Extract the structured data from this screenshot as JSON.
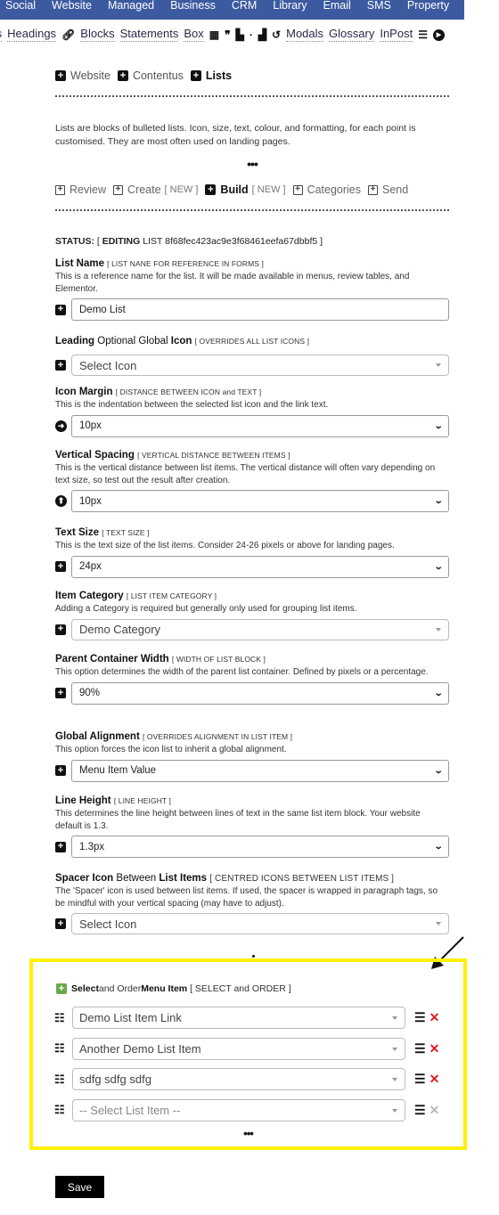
{
  "topnav": {
    "items": [
      "Social",
      "Website",
      "Managed",
      "Business",
      "CRM",
      "Library",
      "Email",
      "SMS",
      "Property"
    ],
    "settings_icon": "gear-icon"
  },
  "toolbar": {
    "items": [
      {
        "type": "link",
        "label": "ts"
      },
      {
        "type": "link",
        "label": "Headings"
      },
      {
        "type": "icon",
        "icon": "link-icon",
        "glyph": "🔗"
      },
      {
        "type": "link",
        "label": "Blocks"
      },
      {
        "type": "link",
        "label": "Statements"
      },
      {
        "type": "link",
        "label": "Box"
      },
      {
        "type": "icon",
        "icon": "calculator-icon",
        "glyph": "▦"
      },
      {
        "type": "icon",
        "icon": "quote-icon",
        "glyph": "❞"
      },
      {
        "type": "icon",
        "icon": "scroll-icon",
        "glyph": "▙"
      },
      {
        "type": "icon",
        "icon": "dot-icon",
        "glyph": "·"
      },
      {
        "type": "icon",
        "icon": "door-icon",
        "glyph": "▟"
      },
      {
        "type": "icon",
        "icon": "undo-icon",
        "glyph": "↺"
      },
      {
        "type": "link",
        "label": "Modals"
      },
      {
        "type": "link",
        "label": "Glossary"
      },
      {
        "type": "link",
        "label": "InPost"
      },
      {
        "type": "icon",
        "icon": "list-icon",
        "glyph": "☰"
      },
      {
        "type": "icon",
        "icon": "play-circle-icon",
        "glyph": "▶"
      }
    ]
  },
  "breadcrumb": [
    {
      "label": "Website",
      "active": false
    },
    {
      "label": "Contentus",
      "active": false
    },
    {
      "label": "Lists",
      "active": true
    }
  ],
  "intro": "Lists are blocks of bulleted lists. Icon, size, text, colour, and formatting, for each point is customised. They are most often used on landing pages.",
  "ellipsis": "•••",
  "tabs": [
    {
      "label": "Review",
      "tag": "",
      "active": false
    },
    {
      "label": "Create",
      "tag": "[ NEW ]",
      "active": false
    },
    {
      "label": "Build",
      "tag": "[ NEW ]",
      "active": true
    },
    {
      "label": "Categories",
      "tag": "",
      "active": false
    },
    {
      "label": "Send",
      "tag": "",
      "active": false
    }
  ],
  "status": {
    "label": "STATUS:",
    "open": "[",
    "mode": "EDITING",
    "text": "LIST 8f68fec423ac9e3f68461eefa67dbbf5",
    "close": "]"
  },
  "fields": {
    "list_name": {
      "label": "List Name",
      "hint": "[ LIST NANE FOR REFERENCE IN FORMS ]",
      "desc": "This is a reference name for the list. It will be made available in menus, review tables, and Elementor.",
      "value": "Demo List"
    },
    "leading_icon": {
      "label_bold1": "Leading",
      "label_norm": " Optional Global ",
      "label_bold2": "Icon",
      "hint": "[ OVERRIDES ALL LIST ICONS ]",
      "value": "Select Icon"
    },
    "icon_margin": {
      "label": "Icon Margin",
      "hint": "[ DISTANCE BETWEEN ICON and TEXT ]",
      "desc": "This is the indentation between the selected list icon and the link text.",
      "value": "10px"
    },
    "vertical_spacing": {
      "label": "Vertical Spacing",
      "hint": "[ VERTICAL DISTANCE BETWEEN ITEMS ]",
      "desc": "This is the vertical distance between list items. The vertical distance will often vary depending on text size, so test out the result after creation.",
      "value": "10px"
    },
    "text_size": {
      "label": "Text Size",
      "hint": "[ TEXT SIZE ]",
      "desc": "This is the text size of the list items. Consider 24-26 pixels or above for landing pages.",
      "value": "24px"
    },
    "item_category": {
      "label": "Item Category",
      "hint": "[ LIST ITEM CATEGORY ]",
      "desc": "Adding a Category is required but generally only used for grouping list items.",
      "value": "Demo Category"
    },
    "container_width": {
      "label": "Parent Container Width",
      "hint": "[ WIDTH OF LIST BLOCK ]",
      "desc": "This option determines the width of the parent list container. Defined by pixels or a percentage.",
      "value": "90%"
    },
    "global_alignment": {
      "label": "Global Alignment",
      "hint": "[ OVERRIDES ALIGNMENT IN LIST ITEM ]",
      "desc": "This option forces the icon list to inherit a global alignment.",
      "value": "Menu Item Value"
    },
    "line_height": {
      "label": "Line Height",
      "hint": "[ LINE HEIGHT ]",
      "desc": "This determines the line height between lines of text in the same list item block. Your website default is 1.3.",
      "value": "1.3px"
    },
    "spacer_icon": {
      "label_bold1": "Spacer Icon",
      "label_norm": " Between ",
      "label_bold2": "List Items",
      "hint": "[ CENTRED ICONS BETWEEN LIST ITEMS ]",
      "desc": "The 'Spacer' icon is used between list items. If used, the spacer is wrapped in paragraph tags, so be mindful with your vertical spacing (may have to adjust).",
      "value": "Select Icon"
    }
  },
  "menu_items": {
    "title_bold1": "Select",
    "title_norm": " and Order ",
    "title_bold2": "Menu Item",
    "hint": "[ SELECT and ORDER ]",
    "items": [
      {
        "value": "Demo List Item Link",
        "placeholder": false,
        "removable": true
      },
      {
        "value": "Another Demo List Item",
        "placeholder": false,
        "removable": true
      },
      {
        "value": "sdfg sdfg sdfg",
        "placeholder": false,
        "removable": true
      },
      {
        "value": "-- Select List Item --",
        "placeholder": true,
        "removable": false
      }
    ],
    "more": "•••"
  },
  "colors": {
    "nav_bg": "#3b5aa0",
    "highlight": "#fff200",
    "remove": "#e01b1b",
    "add_green": "#6aa84f"
  },
  "save_label": "Save"
}
